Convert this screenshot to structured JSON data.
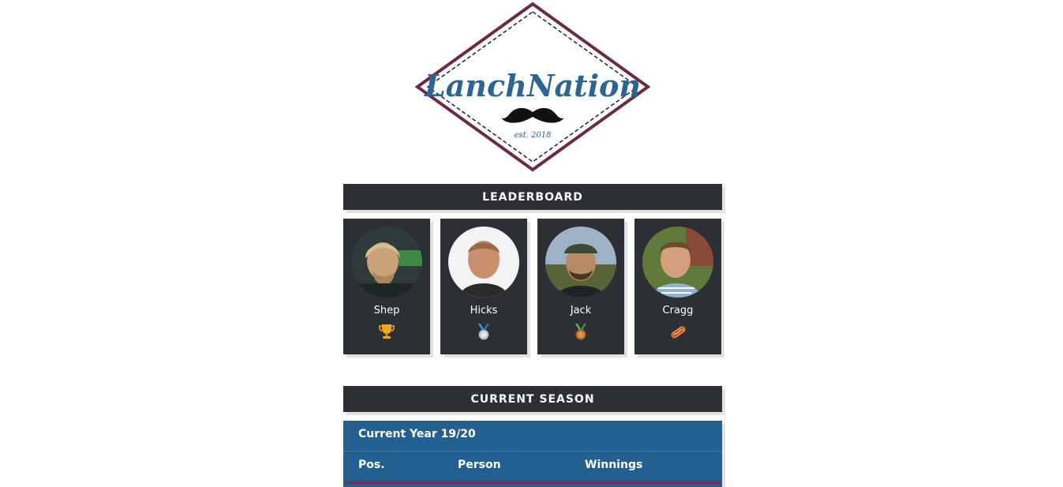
{
  "logo": {
    "name": "LanchNation",
    "tagline": "est. 2018",
    "colors": {
      "border": "#6b2b41",
      "text": "#2c6594",
      "mustache": "#111111"
    }
  },
  "leaderboard": {
    "title": "LEADERBOARD",
    "players": [
      {
        "name": "Shep",
        "award_icon": "trophy-icon"
      },
      {
        "name": "Hicks",
        "award_icon": "silver-medal-icon"
      },
      {
        "name": "Jack",
        "award_icon": "bronze-medal-icon"
      },
      {
        "name": "Cragg",
        "award_icon": "hotdog-icon"
      }
    ]
  },
  "current_season": {
    "title": "CURRENT SEASON",
    "year_label": "Current Year 19/20",
    "columns": [
      "Pos.",
      "Person",
      "Winnings"
    ]
  },
  "colors": {
    "dark_panel": "#2c2f33",
    "table_blue": "#23608f",
    "shadow": "#e2e2e2"
  }
}
